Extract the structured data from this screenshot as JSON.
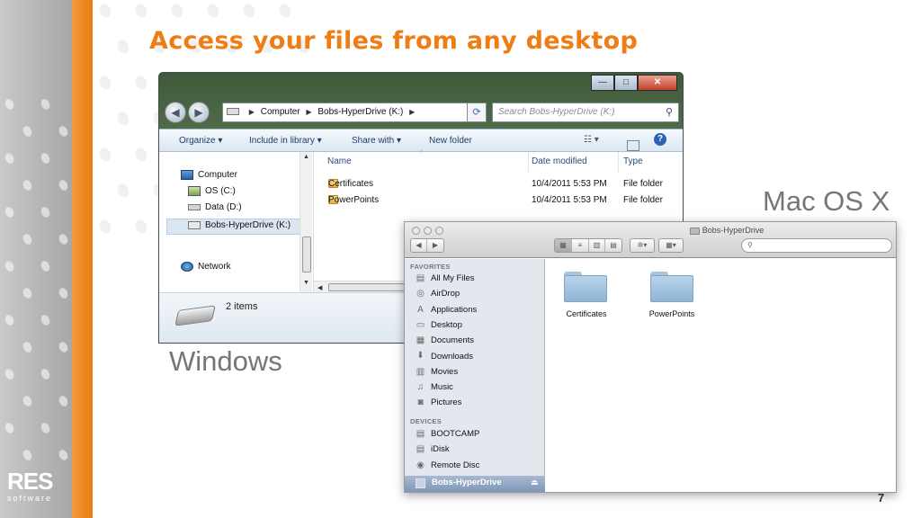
{
  "slide": {
    "title": "Access your files from any desktop",
    "label_mac": "Mac OS X",
    "label_windows": "Windows",
    "page_number": "7",
    "logo": {
      "name": "RES",
      "sub": "software"
    },
    "colors": {
      "accent": "#ee7d15",
      "label_gray": "#767676"
    }
  },
  "windows": {
    "title_buttons": [
      "minimize",
      "maximize",
      "close"
    ],
    "address": {
      "crumbs": [
        "Computer",
        "Bobs-HyperDrive (K:)"
      ]
    },
    "search_placeholder": "Search Bobs-HyperDrive (K:)",
    "toolbar": {
      "organize": "Organize ▾",
      "include_library": "Include in library ▾",
      "share_with": "Share with ▾",
      "new_folder": "New folder"
    },
    "nav": [
      {
        "label": "Computer",
        "icon": "computer-icon"
      },
      {
        "label": "OS (C:)",
        "icon": "drive-icon"
      },
      {
        "label": "Data (D:)",
        "icon": "drive-icon"
      },
      {
        "label": "Bobs-HyperDrive (K:)",
        "icon": "drive-icon",
        "selected": true
      },
      {
        "label": "Network",
        "icon": "network-icon"
      }
    ],
    "columns": {
      "name": "Name",
      "date": "Date modified",
      "type": "Type"
    },
    "files": [
      {
        "name": "Certificates",
        "date": "10/4/2011 5:53 PM",
        "type": "File folder"
      },
      {
        "name": "PowerPoints",
        "date": "10/4/2011 5:53 PM",
        "type": "File folder"
      }
    ],
    "status": "2 items"
  },
  "mac": {
    "window_title": "Bobs-HyperDrive",
    "sidebar": {
      "favorites_header": "FAVORITES",
      "favorites": [
        {
          "label": "All My Files",
          "icon": "all-files-icon",
          "glyph": "▤"
        },
        {
          "label": "AirDrop",
          "icon": "airdrop-icon",
          "glyph": "◎"
        },
        {
          "label": "Applications",
          "icon": "applications-icon",
          "glyph": "A"
        },
        {
          "label": "Desktop",
          "icon": "desktop-icon",
          "glyph": "▭"
        },
        {
          "label": "Documents",
          "icon": "documents-icon",
          "glyph": "▦"
        },
        {
          "label": "Downloads",
          "icon": "downloads-icon",
          "glyph": "⬇"
        },
        {
          "label": "Movies",
          "icon": "movies-icon",
          "glyph": "▥"
        },
        {
          "label": "Music",
          "icon": "music-icon",
          "glyph": "♫"
        },
        {
          "label": "Pictures",
          "icon": "pictures-icon",
          "glyph": "◙"
        }
      ],
      "devices_header": "DEVICES",
      "devices": [
        {
          "label": "BOOTCAMP",
          "icon": "disk-icon",
          "glyph": "▤"
        },
        {
          "label": "iDisk",
          "icon": "idisk-icon",
          "glyph": "▤"
        },
        {
          "label": "Remote Disc",
          "icon": "remote-disc-icon",
          "glyph": "◉"
        }
      ],
      "selected_device": "Bobs-HyperDrive"
    },
    "folders": [
      "Certificates",
      "PowerPoints"
    ]
  }
}
